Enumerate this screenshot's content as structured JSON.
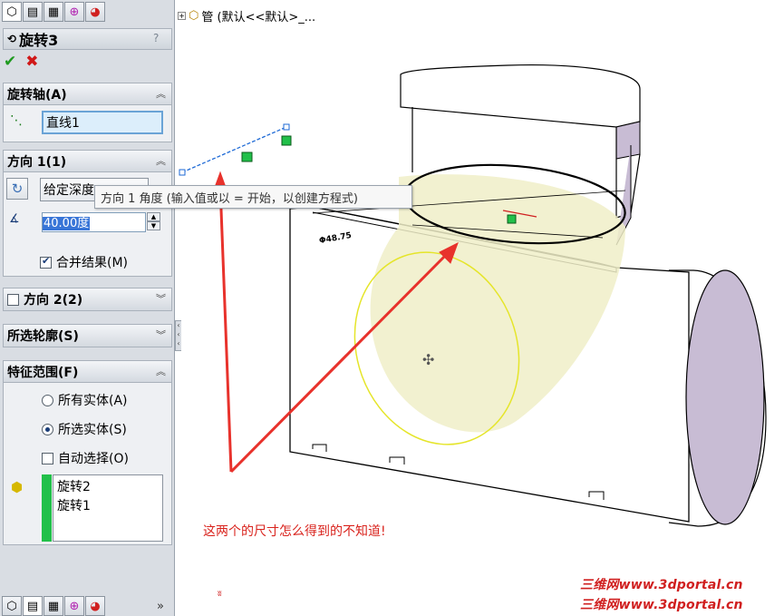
{
  "panel": {
    "feature_name": "旋转3",
    "help": "?",
    "ok_icon": "check-icon",
    "cancel_icon": "x-icon",
    "axis_group": {
      "title": "旋转轴(A)",
      "value": "直线1"
    },
    "direction1": {
      "title": "方向 1(1)",
      "type_value": "给定深度",
      "angle_value": "40.00度",
      "merge_label": "合并结果(M)",
      "merge_checked": true
    },
    "direction2": {
      "title": "方向 2(2)",
      "checked": false
    },
    "selected_contours": {
      "title": "所选轮廓(S)"
    },
    "feature_scope": {
      "title": "特征范围(F)",
      "options": [
        "所有实体(A)",
        "所选实体(S)"
      ],
      "selected_option": "所选实体(S)",
      "auto_select_label": "自动选择(O)",
      "auto_select_checked": false,
      "bodies": [
        "旋转2",
        "旋转1"
      ]
    }
  },
  "graphics": {
    "tree_root_label": "管 (默认<<默认>_...",
    "tooltip": "方向 1 角度 (输入值或以 = 开始，以创建方程式)",
    "caption": "这两个的尺寸怎么得到的不知道!",
    "dimension_label": "Φ48.75",
    "watermark": "三维网www.3dportal.cn"
  },
  "colors": {
    "arrow": "#e8322c",
    "surface": "#f0eec8",
    "profile_edge": "#e5e52a",
    "side_face": "#c8bcd4",
    "accent_green": "#22c04a"
  }
}
